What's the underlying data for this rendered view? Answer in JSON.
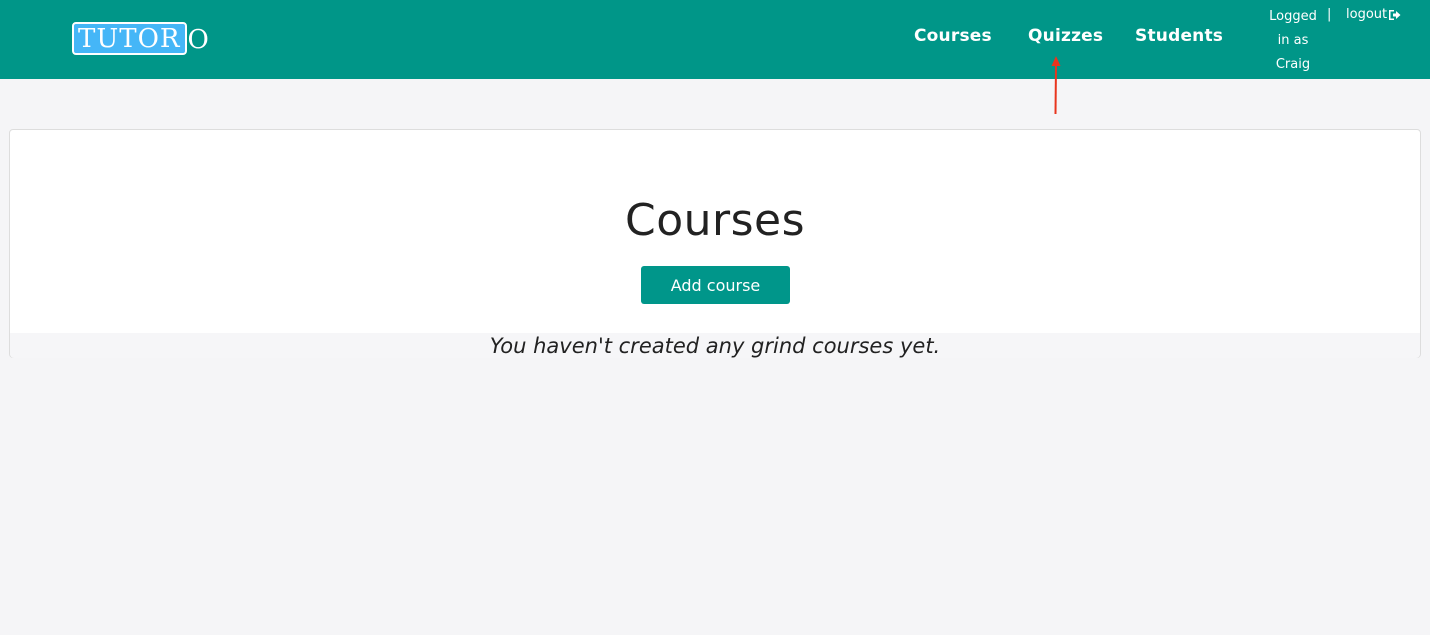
{
  "header": {
    "logo": {
      "boxed": "TUTOR",
      "tail": "O"
    },
    "nav": {
      "courses": "Courses",
      "quizzes": "Quizzes",
      "students": "Students"
    },
    "user": {
      "line1": "Logged",
      "line2": "in as",
      "line3": "Craig",
      "separator": "|",
      "logout": "logout",
      "logout_icon": "sign-out-icon"
    }
  },
  "main": {
    "title": "Courses",
    "add_button": "Add course",
    "empty_message": "You haven't created any grind courses yet."
  },
  "annotation": {
    "arrow_color": "#e8351e",
    "arrow_icon": "arrow-up-icon"
  },
  "colors": {
    "brand": "#009688",
    "logo_box": "#45b6f7",
    "page_bg": "#f5f5f7"
  }
}
